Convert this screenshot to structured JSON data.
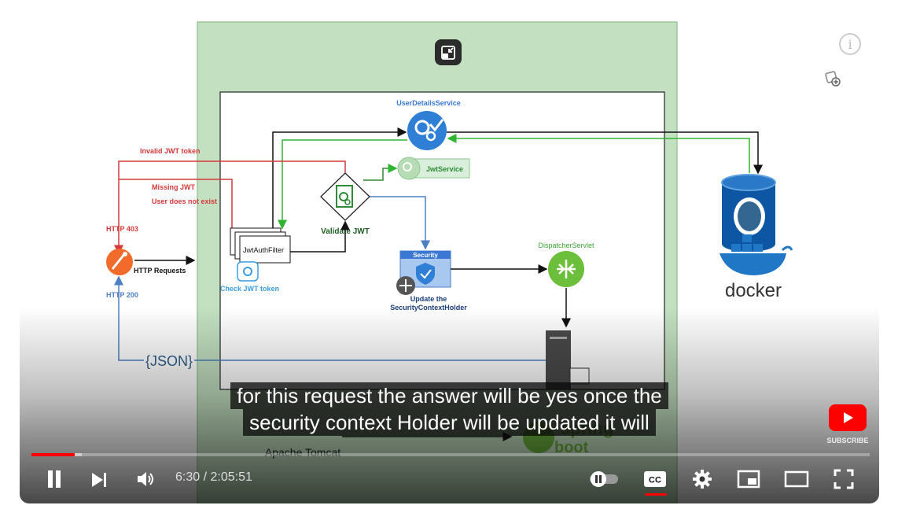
{
  "diagram": {
    "user_details_service": "UserDetailsService",
    "jwt_service": "JwtService",
    "invalid_jwt": "Invalid JWT token",
    "missing_jwt": "Missing JWT",
    "user_not_exist": "User does not exist",
    "http_403": "HTTP 403",
    "http_200": "HTTP 200",
    "http_requests": "HTTP Requests",
    "jwt_auth_filter": "JwtAuthFilter",
    "check_jwt_token": "Check JWT token",
    "validate_jwt": "Validate JWT",
    "security": "Security",
    "update_holder_1": "Update the",
    "update_holder_2": "SecurityContextHolder",
    "dispatcher_servlet": "DispatcherServlet",
    "json": "{JSON}",
    "apache_tomcat": "Apache Tomcat",
    "spring": "spring",
    "boot": "boot",
    "docker": "docker"
  },
  "captions": {
    "line1": "for this request the answer will be yes once the",
    "line2": "security context Holder will be updated it will"
  },
  "player": {
    "time_display": "6:30 / 2:05:51",
    "current_time": "6:30",
    "duration": "2:05:51",
    "progress_fraction": 0.052,
    "subscribe_label": "SUBSCRIBE",
    "info_label": "i",
    "cc_label": "CC",
    "accent_color": "#ff0000"
  },
  "icons": [
    "exit-miniplayer-icon",
    "info-icon",
    "add-to-queue-icon",
    "pause-icon",
    "next-icon",
    "volume-icon",
    "autoplay-toggle-icon",
    "captions-icon",
    "settings-icon",
    "miniplayer-icon",
    "theater-icon",
    "fullscreen-icon",
    "subscribe-icon"
  ]
}
